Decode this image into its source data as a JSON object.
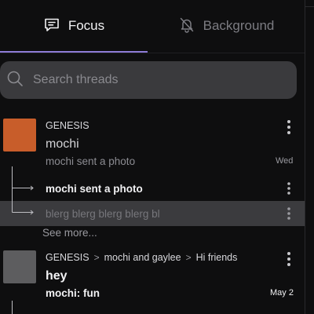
{
  "tabs": {
    "focus": {
      "label": "Focus",
      "icon": "chat-bubble-icon"
    },
    "background": {
      "label": "Background",
      "icon": "bell-off-icon"
    },
    "active": "focus",
    "accent": "#8d7bd6"
  },
  "search": {
    "placeholder": "Search threads",
    "icon": "search-icon"
  },
  "threads": [
    {
      "avatar_color": "#c85d2a",
      "group": "GENESIS",
      "title": "mochi",
      "preview": "mochi sent a photo",
      "date": "Wed",
      "replies": [
        {
          "text": "mochi sent a photo"
        },
        {
          "text": "blerg blerg blerg blerg bl"
        }
      ],
      "see_more": "See more..."
    },
    {
      "avatar_color": "#5d5d5f",
      "breadcrumb": [
        "GENESIS",
        "mochi and gaylee",
        "Hi friends"
      ],
      "breadcrumb_separator": ">",
      "title": "hey",
      "preview": "mochi: fun",
      "date": "May 2"
    }
  ]
}
